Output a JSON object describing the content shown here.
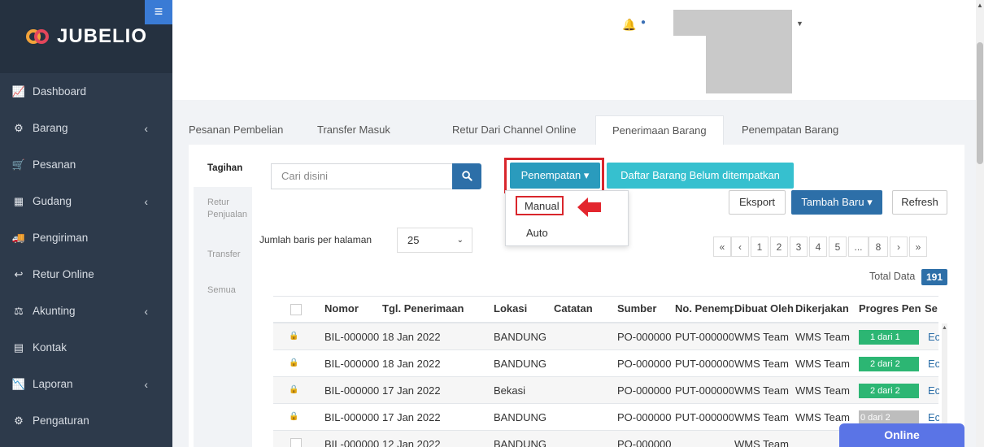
{
  "sidebar": {
    "brand": "JUBELIO",
    "hamburger": "≡",
    "items": [
      {
        "label": "Dashboard",
        "icon": "📈"
      },
      {
        "label": "Barang",
        "icon": "⚙"
      },
      {
        "label": "Pesanan",
        "icon": "🛒"
      },
      {
        "label": "Gudang",
        "icon": "▦"
      },
      {
        "label": "Pengiriman",
        "icon": "🚚"
      },
      {
        "label": "Retur Online",
        "icon": "↩"
      },
      {
        "label": "Akunting",
        "icon": "⚖"
      },
      {
        "label": "Kontak",
        "icon": "▤"
      },
      {
        "label": "Laporan",
        "icon": "📉"
      },
      {
        "label": "Pengaturan",
        "icon": "⚙"
      }
    ],
    "chevron": "‹"
  },
  "tabs": [
    "Pesanan Pembelian",
    "Transfer Masuk",
    "Retur Dari Channel Online",
    "Penerimaan Barang",
    "Penempatan Barang"
  ],
  "subnav": [
    "Tagihan",
    "Retur Penjualan",
    "Transfer",
    "Semua"
  ],
  "search": {
    "placeholder": "Cari disini",
    "icon": "🔍"
  },
  "buttons": {
    "penempatan": "Penempatan ▾",
    "daftar": "Daftar Barang Belum ditempatkan",
    "eksport": "Eksport",
    "tambah": "Tambah Baru ▾",
    "refresh": "Refresh"
  },
  "dropdown": {
    "manual": "Manual",
    "auto": "Auto"
  },
  "rows_per_page": {
    "label": "Jumlah baris per halaman",
    "value": "25",
    "arrow": "⌄"
  },
  "pagination": [
    "«",
    "‹",
    "1",
    "2",
    "3",
    "4",
    "5",
    "...",
    "8",
    "›",
    "»"
  ],
  "total": {
    "label": "Total Data",
    "value": "191"
  },
  "table": {
    "headers": [
      "Nomor",
      "Tgl. Penerimaan",
      "Lokasi",
      "Catatan",
      "Sumber",
      "No. Penemp",
      "Dibuat Oleh",
      "Dikerjakan",
      "Progres Pen",
      "Se"
    ],
    "rows": [
      {
        "nomor": "BIL-000000",
        "tgl": "18 Jan 2022",
        "lokasi": "BANDUNG",
        "catatan": "",
        "sumber": "PO-000000",
        "no_penemp": "PUT-000000",
        "dibuat": "WMS Team",
        "dikerjakan": "WMS Team",
        "progres": "1 dari 1",
        "prog_color": "green",
        "se": "Ec"
      },
      {
        "nomor": "BIL-000000",
        "tgl": "18 Jan 2022",
        "lokasi": "BANDUNG",
        "catatan": "",
        "sumber": "PO-000000",
        "no_penemp": "PUT-000000",
        "dibuat": "WMS Team",
        "dikerjakan": "WMS Team",
        "progres": "2 dari 2",
        "prog_color": "green",
        "se": "Ec"
      },
      {
        "nomor": "BIL-000000",
        "tgl": "17 Jan 2022",
        "lokasi": "Bekasi",
        "catatan": "",
        "sumber": "PO-000000",
        "no_penemp": "PUT-000000",
        "dibuat": "WMS Team",
        "dikerjakan": "WMS Team",
        "progres": "2 dari 2",
        "prog_color": "green",
        "se": "Ec"
      },
      {
        "nomor": "BIL-000000",
        "tgl": "17 Jan 2022",
        "lokasi": "BANDUNG",
        "catatan": "",
        "sumber": "PO-000000",
        "no_penemp": "PUT-000000",
        "dibuat": "WMS Team",
        "dikerjakan": "WMS Team",
        "progres": "0 dari 2",
        "prog_color": "gray",
        "se": "Ec"
      },
      {
        "nomor": "BIL-000000",
        "tgl": "12 Jan 2022",
        "lokasi": "BANDUNG",
        "catatan": "",
        "sumber": "PO-000000",
        "no_penemp": "",
        "dibuat": "WMS Team",
        "dikerjakan": "",
        "progres": "",
        "prog_color": "",
        "se": ""
      }
    ]
  },
  "online_badge": "Online",
  "colors": {
    "sidebar": "#2d3a4b",
    "primary": "#2d6fa8",
    "teal": "#2a9bbd",
    "cyan": "#36c0cf",
    "highlight": "#d9262c",
    "progress_green": "#2cb673",
    "online": "#5a74e6"
  }
}
